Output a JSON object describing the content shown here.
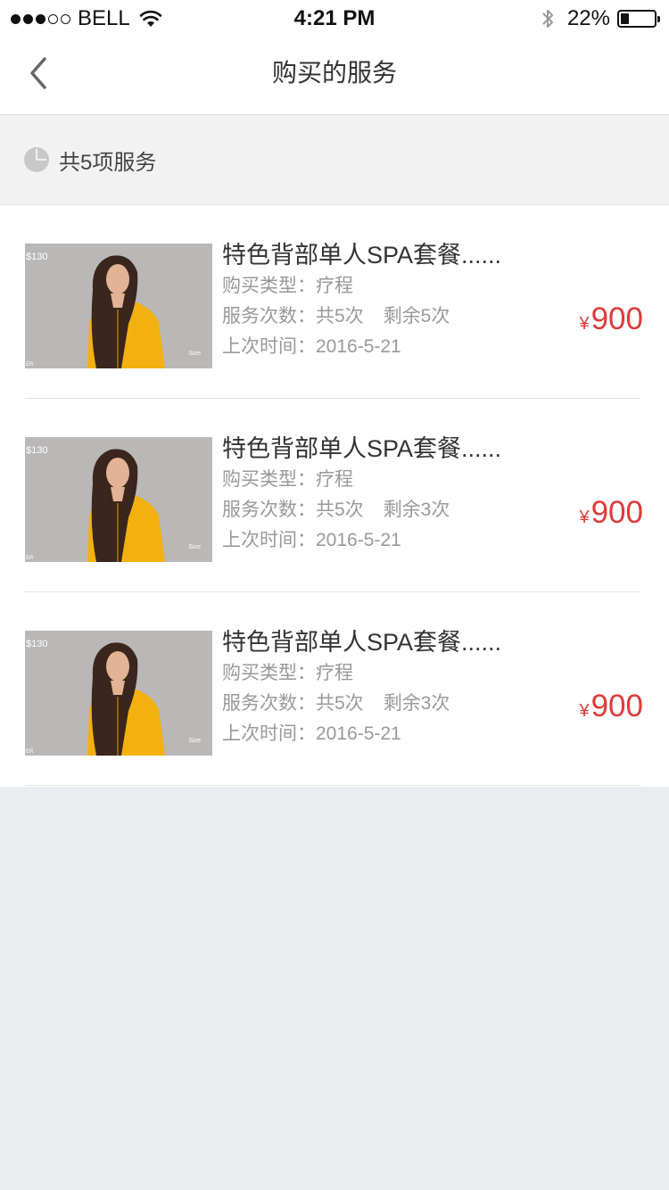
{
  "status_bar": {
    "carrier": "BELL",
    "time": "4:21 PM",
    "battery_percent": "22%",
    "battery_level": 0.22,
    "signal_bars_filled": 3,
    "signal_bars_total": 5
  },
  "nav": {
    "title": "购买的服务",
    "back_icon": "chevron-left-icon"
  },
  "summary": {
    "icon": "pie-chart-icon",
    "text": "共5项服务"
  },
  "colors": {
    "price": "#e03a3a",
    "background": "#e9edf0",
    "secondary_text": "#999999"
  },
  "services": [
    {
      "title": "特色背部单人SPA套餐......",
      "type_label": "购买类型：",
      "type_value": "疗程",
      "count_label": "服务次数：",
      "count_total": "共5次",
      "count_remaining": "剩余5次",
      "last_label": "上次时间：",
      "last_value": "2016-5-21",
      "currency": "¥",
      "price": "900",
      "thumb_price": "$130",
      "thumb_size": "Size",
      "thumb_er": "ER"
    },
    {
      "title": "特色背部单人SPA套餐......",
      "type_label": "购买类型：",
      "type_value": "疗程",
      "count_label": "服务次数：",
      "count_total": "共5次",
      "count_remaining": "剩余3次",
      "last_label": "上次时间：",
      "last_value": "2016-5-21",
      "currency": "¥",
      "price": "900",
      "thumb_price": "$130",
      "thumb_size": "Size",
      "thumb_er": "ER"
    },
    {
      "title": "特色背部单人SPA套餐......",
      "type_label": "购买类型：",
      "type_value": "疗程",
      "count_label": "服务次数：",
      "count_total": "共5次",
      "count_remaining": "剩余3次",
      "last_label": "上次时间：",
      "last_value": "2016-5-21",
      "currency": "¥",
      "price": "900",
      "thumb_price": "$130",
      "thumb_size": "Size",
      "thumb_er": "ER"
    }
  ]
}
